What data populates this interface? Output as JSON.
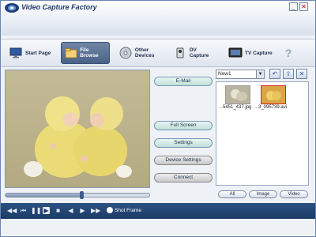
{
  "app": {
    "title": "Video Capture Factory"
  },
  "window_controls": {
    "minimize": "_",
    "close": "✕"
  },
  "toolbar": {
    "items": [
      {
        "label": "Start Page",
        "icon": "monitor-icon"
      },
      {
        "label": "File Browse",
        "icon": "folder-icon",
        "active": true
      },
      {
        "label": "Other Devices",
        "icon": "disc-icon"
      },
      {
        "label": "DV Capture",
        "icon": "camcorder-icon"
      },
      {
        "label": "TV Capture",
        "icon": "tv-icon"
      },
      {
        "label": "?",
        "icon": "help-icon"
      }
    ]
  },
  "actions": {
    "email": "E-Mail",
    "full_screen": "Full Screen",
    "settings": "Settings",
    "device_settings": "Device Settings",
    "connect": "Connect"
  },
  "file_panel": {
    "folder": "New1",
    "files": [
      {
        "name": "...5451_437.jpg",
        "selected": false
      },
      {
        "name": "...3_095739.avi",
        "selected": true
      }
    ],
    "filters": {
      "all": "All",
      "image": "Image",
      "video": "Video"
    }
  },
  "playback": {
    "seek_progress": 0.53,
    "shot_frame_label": "Shot Frame",
    "buttons": [
      "rewind-icon",
      "skip-back-icon",
      "pause-icon",
      "play-icon",
      "stop-icon",
      "step-back-icon",
      "step-forward-icon",
      "fast-forward-icon"
    ]
  },
  "colors": {
    "accent": "#2c5282",
    "selected_border": "#dd2222"
  }
}
